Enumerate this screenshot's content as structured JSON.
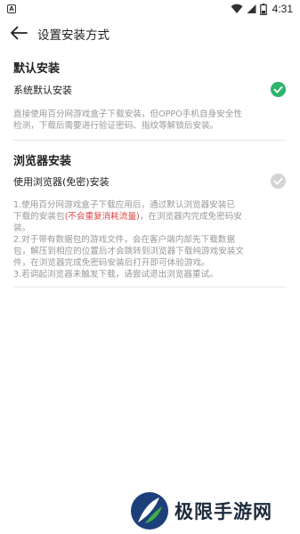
{
  "status_bar": {
    "time": "4:31",
    "icons": [
      "app-notification-icon",
      "wifi-icon",
      "signal-icon",
      "battery-icon"
    ]
  },
  "app_bar": {
    "title": "设置安装方式",
    "back_icon": "arrow-left-icon"
  },
  "sections": [
    {
      "title": "默认安装",
      "option_label": "系统默认安装",
      "checked": true,
      "description_lines": [
        "直接使用百分网游戏盒子下载安装，但OPPO手机自身安全性",
        "检测，下载后需要进行验证密码、指纹等解锁后安装。"
      ]
    },
    {
      "title": "浏览器安装",
      "option_label": "使用浏览器(免密)安装",
      "checked": false,
      "description_lines": [
        "1.使用百分网游戏盒子下载应用后，通过默认浏览器安装已",
        "2.对于带有数据包的游戏文件，会在客户端内部先下载数据",
        "包，解压到相应的位置后才会跳转到浏览器下载纯游戏安装文",
        "件，在浏览器完成免密码安装后打开即可体验游戏。",
        "3.若调起浏览器未触发下载，请尝试退出浏览器重试。"
      ],
      "line2_prefix": "下载的安装包",
      "line2_highlight": "(不会重复消耗流量)",
      "line2_suffix": "，在浏览器内完成免密码安",
      "line3": "装。"
    }
  ],
  "colors": {
    "check_on": "#2db56b",
    "check_off": "#d4d4d4",
    "highlight_red": "#e04848",
    "description_gray": "#999999"
  },
  "watermark": {
    "text": "极限手游网"
  }
}
